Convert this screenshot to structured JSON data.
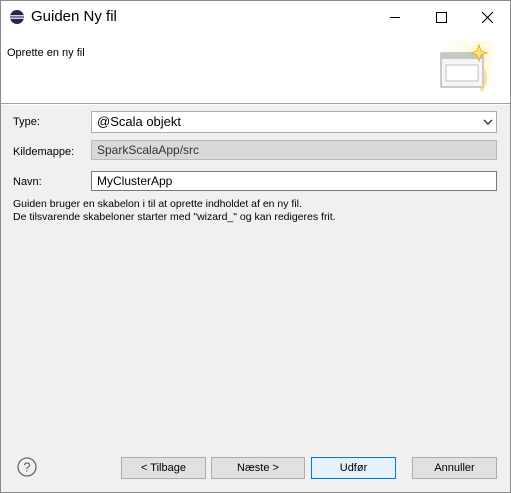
{
  "window": {
    "title": "Guiden Ny fil",
    "icon": "eclipse-icon",
    "controls": [
      "minimize-icon",
      "maximize-icon",
      "close-icon"
    ]
  },
  "banner": {
    "description": "Oprette en ny fil",
    "graphic": "new-file-wizard-icon"
  },
  "form": {
    "type_label": "Type:",
    "type_value": "@Scala objekt",
    "source_label": "Kildemappe:",
    "source_value": "SparkScalaApp/src",
    "name_label": "Navn:",
    "name_value": "MyClusterApp"
  },
  "help_text": {
    "line1": "Guiden bruger en skabelon i til at oprette indholdet af en ny fil.",
    "line2": "De tilsvarende skabeloner starter med \"wizard_\" og kan redigeres frit."
  },
  "buttons": {
    "back": "< Tilbage",
    "next": "Næste >",
    "finish": "Udfør",
    "cancel": "Annuller"
  },
  "colors": {
    "accent": "#0078d7",
    "background": "#f0f0f0"
  }
}
